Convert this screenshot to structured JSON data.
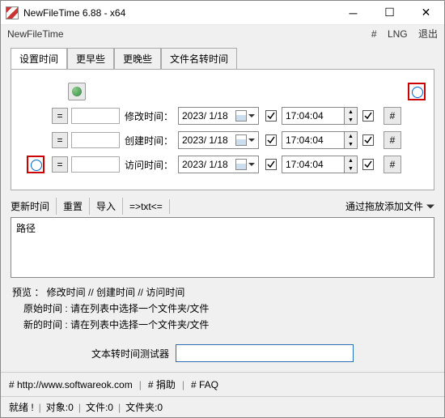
{
  "window": {
    "title": "NewFileTime 6.88 - x64"
  },
  "menubar": {
    "appname": "NewFileTime",
    "hash": "#",
    "lng": "LNG",
    "exit": "退出"
  },
  "tabs": [
    "设置时间",
    "更早些",
    "更晚些",
    "文件名转时间"
  ],
  "rows": {
    "eq": "=",
    "modify": {
      "label": "修改时间：",
      "date": "2023/ 1/18",
      "time": "17:04:04"
    },
    "create": {
      "label": "创建时间：",
      "date": "2023/ 1/18",
      "time": "17:04:04"
    },
    "access": {
      "label": "访问时间：",
      "date": "2023/ 1/18",
      "time": "17:04:04"
    },
    "hash": "#"
  },
  "toolbar": {
    "update": "更新时间",
    "reset": "重置",
    "import": "导入",
    "txt": "=>txt<=",
    "drop": "通过拖放添加文件"
  },
  "list": {
    "pathheader": "路径"
  },
  "preview": {
    "line1": "预览 ：  修改时间    //    创建时间    //    访问时间",
    "orig_lbl": "原始时间 :",
    "orig_val": "请在列表中选择一个文件夹/文件",
    "new_lbl": "新的时间 :",
    "new_val": "请在列表中选择一个文件夹/文件"
  },
  "tester": {
    "label": "文本转时间测试器",
    "value": ""
  },
  "footer": {
    "url": "# http://www.softwareok.com",
    "donate": "# 捐助",
    "faq": "# FAQ"
  },
  "status": {
    "ready": "就绪 !",
    "objects": "对象:0",
    "files": "文件:0",
    "folders": "文件夹:0"
  }
}
